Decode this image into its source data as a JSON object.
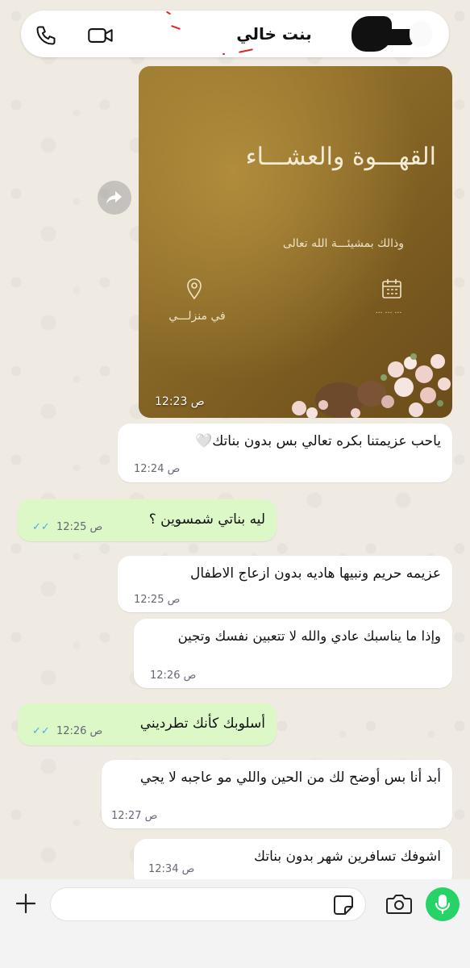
{
  "header": {
    "contact_name": "بنت خالي"
  },
  "image_message": {
    "card_title": "القهـــوة والعشـــاء",
    "card_subtitle": "وذالك بمشيئـــة الله تعالى",
    "location_text": "في منزلـــي",
    "date_text": "… … …",
    "time": "12:23 ص"
  },
  "messages": [
    {
      "direction": "in",
      "text": "ياحب  عزيمتنا بكره  تعالي بس بدون بناتك🤍",
      "time": "12:24 ص"
    },
    {
      "direction": "out",
      "text": "ليه بناتي شمسوين ؟",
      "time": "12:25 ص",
      "status": "read"
    },
    {
      "direction": "in",
      "text": "عزيمه حريم ونبيها هاديه بدون ازعاج الاطفال",
      "time": "12:25 ص"
    },
    {
      "direction": "in",
      "text": "وإذا ما يناسبك عادي والله لا تتعبين نفسك وتجين",
      "time": "12:26 ص"
    },
    {
      "direction": "out",
      "text": "أسلوبك كأنك تطرديني",
      "time": "12:26 ص",
      "status": "read"
    },
    {
      "direction": "in",
      "text": "أبد أنا بس أوضح لك من الحين واللي مو عاجبه لا يجي",
      "time": "12:27 ص"
    },
    {
      "direction": "in",
      "text": "اشوفك تسافرين شهر بدون بناتك",
      "time": "12:34 ص"
    }
  ],
  "composer": {
    "placeholder": ""
  },
  "icons": {
    "call": "phone-icon",
    "video": "video-camera-icon",
    "forward": "forward-arrow-icon",
    "pin": "location-pin-icon",
    "calendar": "calendar-icon",
    "plus": "plus-icon",
    "sticker": "sticker-icon",
    "camera": "camera-icon",
    "mic": "microphone-icon"
  },
  "colors": {
    "incoming_bubble": "#ffffff",
    "outgoing_bubble": "#dcf8c6",
    "read_ticks": "#4fa9e6",
    "mic_button": "#25d366",
    "card_gold": "#8a6a28"
  }
}
